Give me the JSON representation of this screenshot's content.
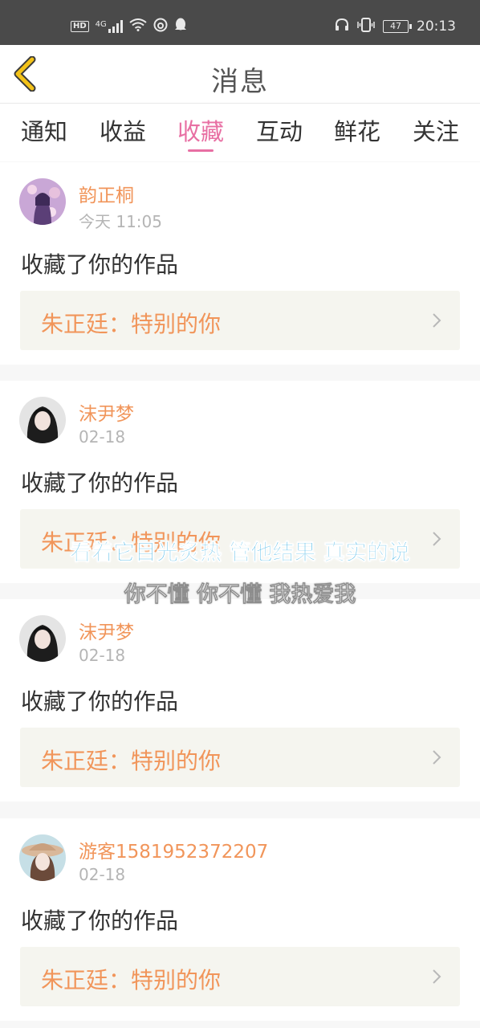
{
  "status_bar": {
    "hd": "HD",
    "network": "4G",
    "battery": "47",
    "time": "20:13",
    "left_icons": [
      "signal-icon",
      "wifi-icon",
      "netease-music-icon",
      "qq-icon"
    ],
    "right_icons": [
      "headset-icon",
      "vibrate-icon",
      "battery-icon"
    ]
  },
  "header": {
    "title": "消息"
  },
  "tabs": [
    {
      "label": "通知",
      "active": false
    },
    {
      "label": "收益",
      "active": false
    },
    {
      "label": "收藏",
      "active": true
    },
    {
      "label": "互动",
      "active": false
    },
    {
      "label": "鲜花",
      "active": false
    },
    {
      "label": "关注",
      "active": false
    }
  ],
  "messages": [
    {
      "username": "韵正桐",
      "time": "今天 11:05",
      "action": "收藏了你的作品",
      "work": "朱正廷：特别的你"
    },
    {
      "username": "沫尹梦",
      "time": "02-18",
      "action": "收藏了你的作品",
      "work": "朱正廷：特别的你"
    },
    {
      "username": "沫尹梦",
      "time": "02-18",
      "action": "收藏了你的作品",
      "work": "朱正廷：特别的你"
    },
    {
      "username": "游客1581952372207",
      "time": "02-18",
      "action": "收藏了你的作品",
      "work": "朱正廷：特别的你"
    }
  ],
  "overlay": {
    "lyric_line_1": "看着它目光炙热 管他结果 真实的说",
    "lyric_line_2": "你不懂 你不懂 我热爱我"
  },
  "colors": {
    "accent": "#e86fa3",
    "username": "#f1955a",
    "back_arrow": "#f3c218",
    "status_bar": "#4a4a4a",
    "work_box": "#f5f5ef"
  }
}
